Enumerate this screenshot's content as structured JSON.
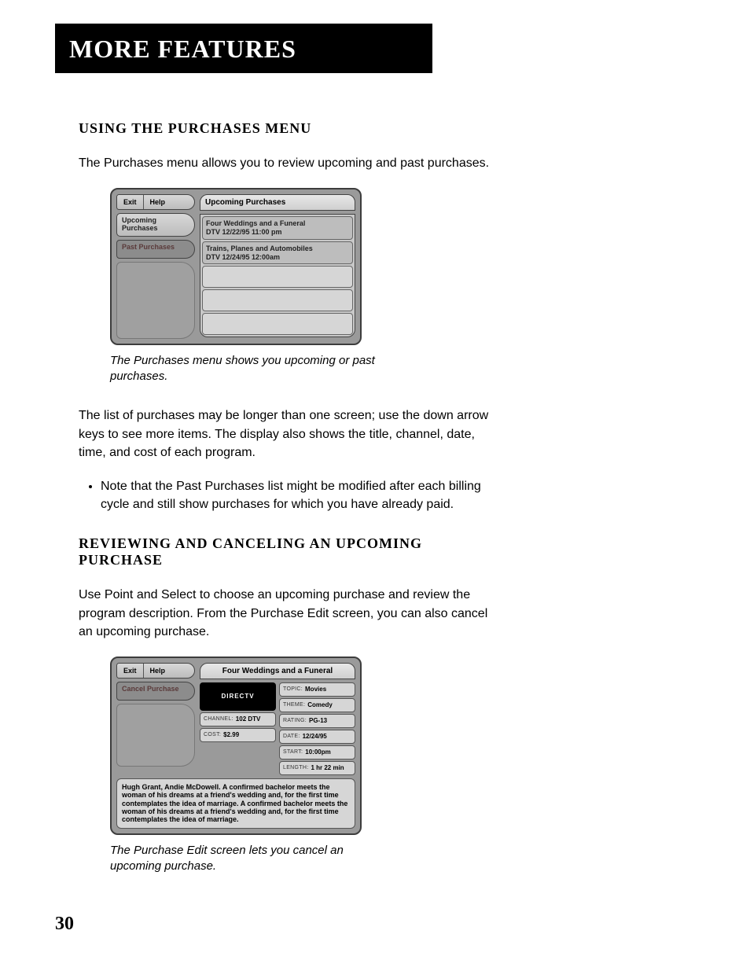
{
  "header": "MORE FEATURES",
  "section1": {
    "title": "USING THE PURCHASES MENU",
    "para1": "The Purchases menu allows you to review upcoming and past purchases.",
    "caption": "The Purchases menu shows you upcoming or past purchases.",
    "para2": "The list of purchases may be longer than one screen; use the down arrow keys to see more items. The display also shows the title, channel, date, time, and cost of each program.",
    "bullet1": "Note that the Past Purchases list might be modified after each billing cycle and still show purchases for which you have already paid."
  },
  "fig1": {
    "exit": "Exit",
    "help": "Help",
    "tab_upcoming": "Upcoming Purchases",
    "tab_past": "Past Purchases",
    "panel_title": "Upcoming Purchases",
    "items": [
      {
        "title": "Four Weddings and a Funeral",
        "line2": "DTV    12/22/95  11:00 pm"
      },
      {
        "title": "Trains, Planes and Automobiles",
        "line2": "DTV    12/24/95  12:00am"
      }
    ]
  },
  "section2": {
    "title": "REVIEWING AND CANCELING AN UPCOMING PURCHASE",
    "para1": "Use Point and Select to choose an upcoming purchase and review the program description. From the Purchase Edit screen, you can also cancel an upcoming purchase.",
    "caption": "The Purchase Edit screen lets you cancel an upcoming purchase."
  },
  "fig2": {
    "exit": "Exit",
    "help": "Help",
    "cancel": "Cancel Purchase",
    "title": "Four Weddings and a Funeral",
    "logo": "DIRECTV",
    "channel_lab": "CHANNEL:",
    "channel_val": "102 DTV",
    "cost_lab": "COST:",
    "cost_val": "$2.99",
    "topic_lab": "TOPIC:",
    "topic_val": "Movies",
    "theme_lab": "THEME:",
    "theme_val": "Comedy",
    "rating_lab": "RATING:",
    "rating_val": "PG-13",
    "date_lab": "DATE:",
    "date_val": "12/24/95",
    "start_lab": "START:",
    "start_val": "10:00pm",
    "length_lab": "LENGTH:",
    "length_val": "1 hr 22 min",
    "description": "Hugh Grant, Andie McDowell. A confirmed bachelor meets the woman of his dreams at a friend's wedding and, for the first time contemplates the idea of marriage. A confirmed bachelor meets the woman of his dreams at a friend's wedding and, for the first time contemplates the idea of marriage."
  },
  "page_number": "30"
}
